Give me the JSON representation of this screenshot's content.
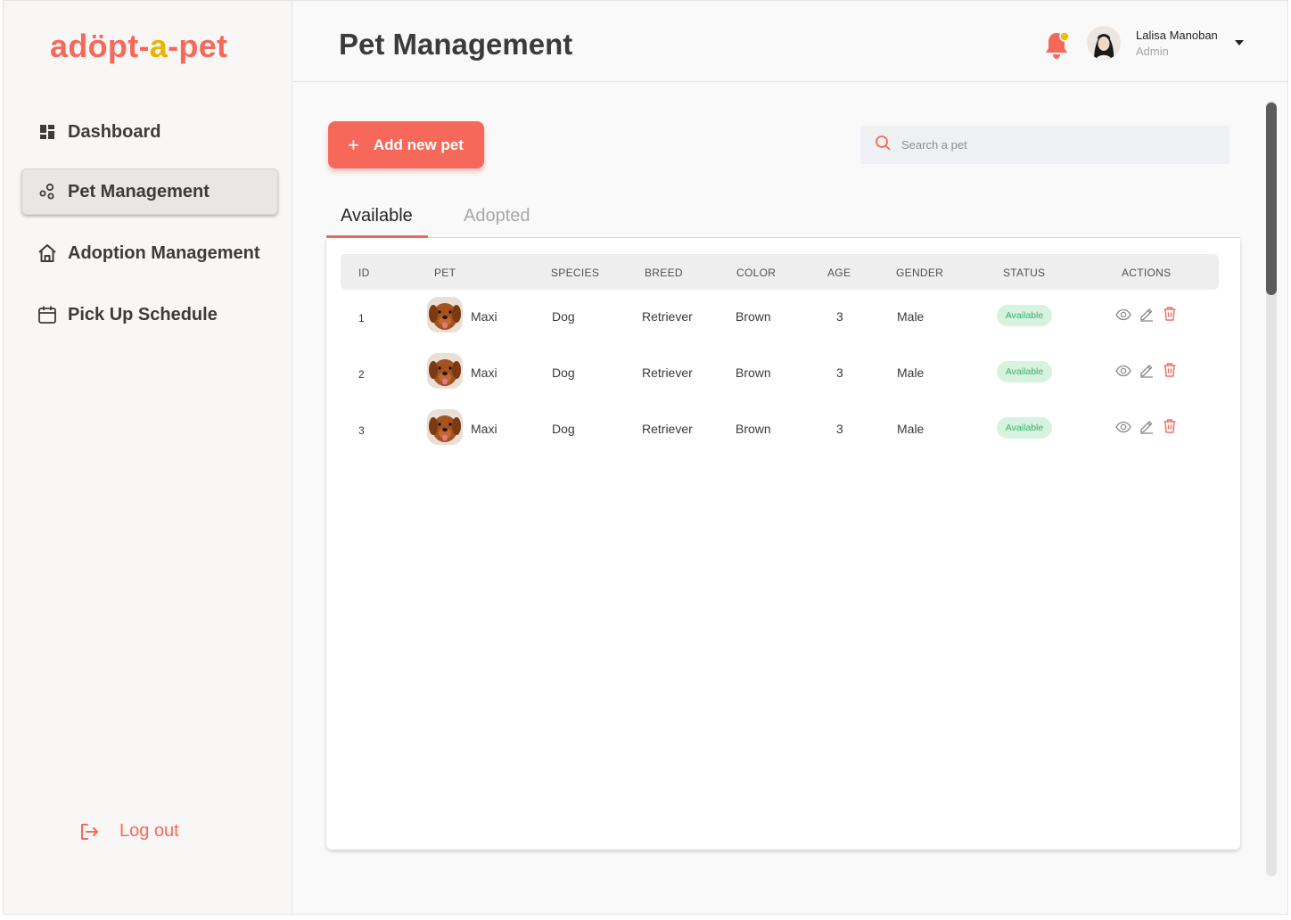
{
  "logo": {
    "part1": "adöpt-",
    "part2": "a",
    "part3": "-pet"
  },
  "sidebar": {
    "items": [
      {
        "label": "Dashboard",
        "icon": "dashboard-grid-icon"
      },
      {
        "label": "Pet Management",
        "icon": "pets-nodes-icon",
        "active": true
      },
      {
        "label": "Adoption Management",
        "icon": "home-icon"
      },
      {
        "label": "Pick Up Schedule",
        "icon": "calendar-icon"
      }
    ],
    "logout_label": "Log out"
  },
  "header": {
    "title": "Pet Management",
    "user_name": "Lalisa Manoban",
    "user_role": "Admin"
  },
  "toolbar": {
    "add_label": "Add new pet",
    "add_icon": "+",
    "search_placeholder": "Search a pet"
  },
  "tabs": [
    {
      "label": "Available",
      "active": true
    },
    {
      "label": "Adopted",
      "active": false
    }
  ],
  "table": {
    "columns": [
      "ID",
      "PET",
      "SPECIES",
      "BREED",
      "COLOR",
      "AGE",
      "GENDER",
      "STATUS",
      "ACTIONS"
    ],
    "rows": [
      {
        "id": "1",
        "pet": "Maxi",
        "species": "Dog",
        "breed": "Retriever",
        "color": "Brown",
        "age": "3",
        "gender": "Male",
        "status": "Available"
      },
      {
        "id": "2",
        "pet": "Maxi",
        "species": "Dog",
        "breed": "Retriever",
        "color": "Brown",
        "age": "3",
        "gender": "Male",
        "status": "Available"
      },
      {
        "id": "3",
        "pet": "Maxi",
        "species": "Dog",
        "breed": "Retriever",
        "color": "Brown",
        "age": "3",
        "gender": "Male",
        "status": "Available"
      }
    ]
  },
  "colors": {
    "accent": "#f6685a",
    "logo_yellow": "#e8b400",
    "badge_bg": "#d7f3e0",
    "badge_text": "#36b163"
  }
}
